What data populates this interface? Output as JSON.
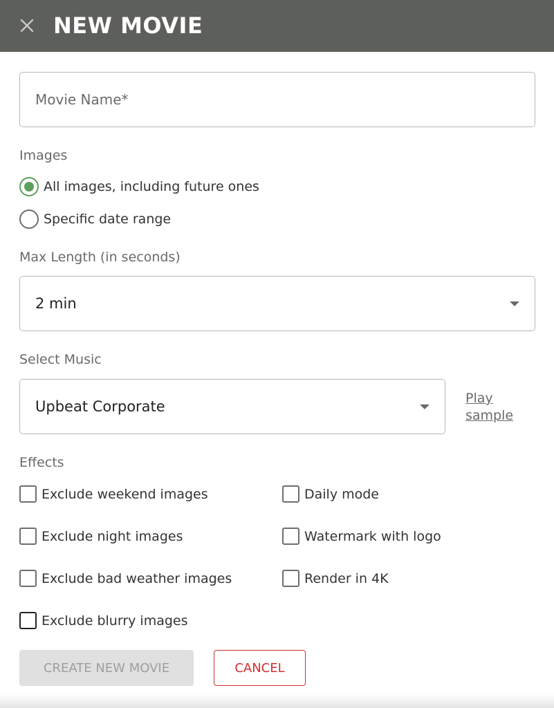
{
  "header": {
    "title": "NEW MOVIE",
    "close_icon": "close-icon",
    "background_color": "#5d5f5b"
  },
  "movie_name": {
    "placeholder": "Movie Name*",
    "value": ""
  },
  "images": {
    "label": "Images",
    "options": [
      {
        "label": "All images, including future ones",
        "selected": true
      },
      {
        "label": "Specific date range",
        "selected": false
      }
    ],
    "accent_color": "#5ba15a"
  },
  "max_length": {
    "label": "Max Length (in seconds)",
    "selected_value": "2 min"
  },
  "music": {
    "label": "Select Music",
    "selected_value": "Upbeat Corporate",
    "play_sample_label": "Play sample"
  },
  "effects": {
    "label": "Effects",
    "left_column": [
      {
        "label": "Exclude weekend images",
        "checked": false
      },
      {
        "label": "Exclude night images",
        "checked": false
      },
      {
        "label": "Exclude bad weather images",
        "checked": false
      },
      {
        "label": "Exclude blurry images",
        "checked": false
      }
    ],
    "right_column": [
      {
        "label": "Daily mode",
        "checked": false
      },
      {
        "label": "Watermark with logo",
        "checked": false
      },
      {
        "label": "Render in 4K",
        "checked": false
      }
    ]
  },
  "actions": {
    "create_label": "CREATE NEW MOVIE",
    "cancel_label": "CANCEL",
    "cancel_color": "#d32f2f"
  }
}
